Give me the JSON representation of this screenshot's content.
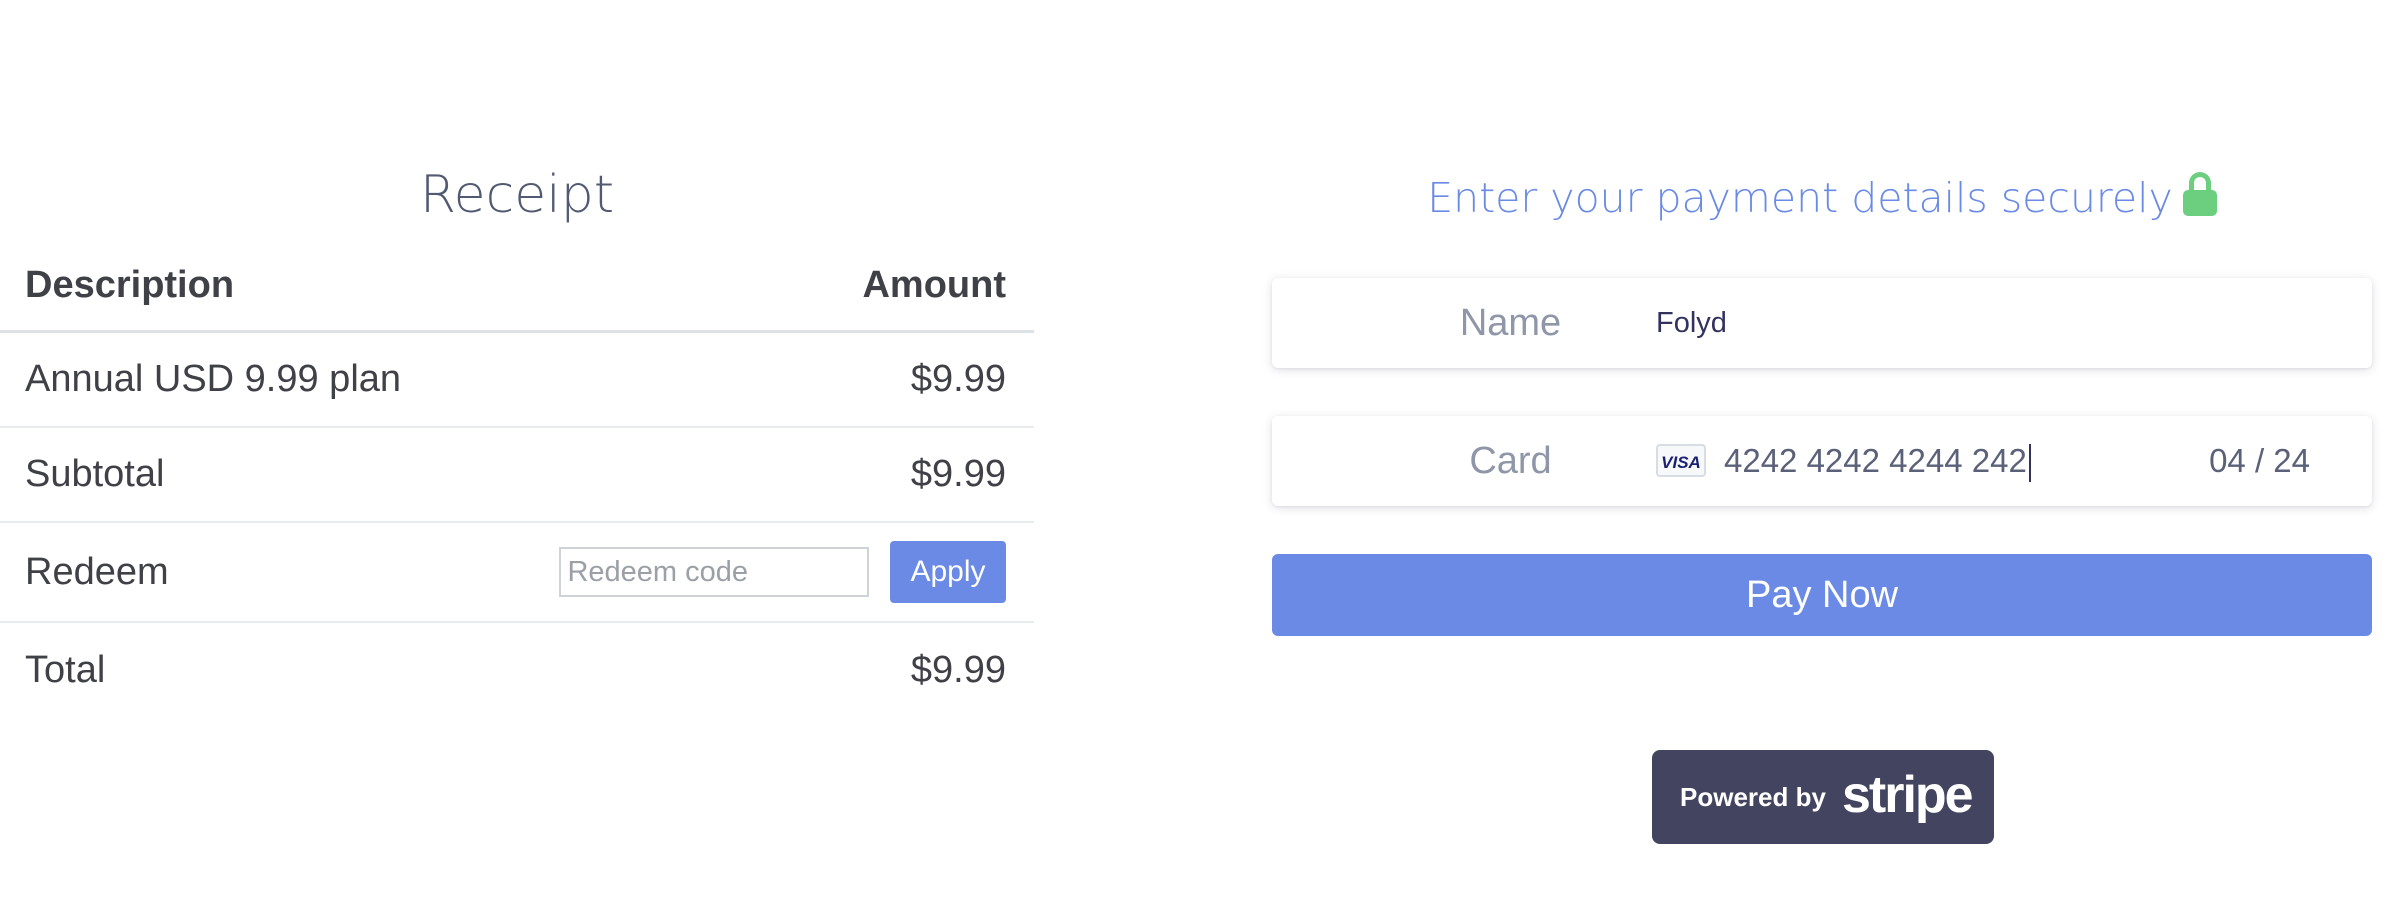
{
  "receipt": {
    "title": "Receipt",
    "headers": {
      "description": "Description",
      "amount": "Amount"
    },
    "rows": [
      {
        "description": "Annual USD 9.99 plan",
        "amount": "$9.99"
      },
      {
        "description": "Subtotal",
        "amount": "$9.99"
      }
    ],
    "redeem": {
      "label": "Redeem",
      "placeholder": "Redeem code",
      "value": "",
      "apply_label": "Apply"
    },
    "total": {
      "label": "Total",
      "amount": "$9.99"
    }
  },
  "payment": {
    "heading": "Enter your payment details securely",
    "lock_icon": "lock-icon",
    "name": {
      "label": "Name",
      "value": "Folyd"
    },
    "card": {
      "label": "Card",
      "brand": "VISA",
      "number": "4242 4242 4244 242",
      "expiry": "04 / 24"
    },
    "pay_button": "Pay Now",
    "powered_by": {
      "prefix": "Powered by",
      "brand": "stripe"
    }
  },
  "colors": {
    "accent": "#6a8ae5",
    "lock": "#6ccf80",
    "stripe_badge": "#434560",
    "text": "#3f4147"
  }
}
